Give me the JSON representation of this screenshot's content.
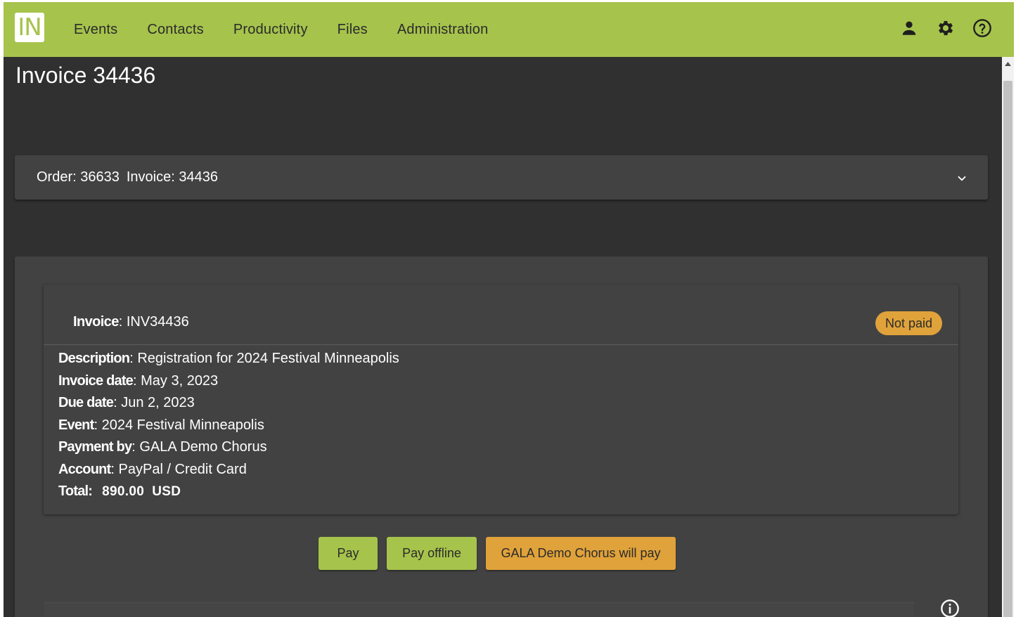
{
  "app": {
    "logo_text": "IN",
    "nav": [
      "Events",
      "Contacts",
      "Productivity",
      "Files",
      "Administration"
    ],
    "icons": [
      "person-icon",
      "gear-icon",
      "help-icon"
    ],
    "colors": {
      "accent": "#a6c34c",
      "warning": "#e0a23a",
      "background": "#303030",
      "card": "#424242"
    }
  },
  "page": {
    "title": "Invoice 34436"
  },
  "order_bar": {
    "order_label": "Order: 36633",
    "invoice_label": "Invoice: 34436"
  },
  "invoice": {
    "header_label": "Invoice",
    "header_value": ": INV34436",
    "status": "Not paid",
    "fields": [
      {
        "label": "Description",
        "value": ": Registration for 2024 Festival Minneapolis"
      },
      {
        "label": "Invoice date",
        "value": ": May 3, 2023"
      },
      {
        "label": "Due date",
        "value": ": Jun 2, 2023"
      },
      {
        "label": "Event",
        "value": ": 2024 Festival Minneapolis"
      },
      {
        "label": "Payment by",
        "value": ": GALA Demo Chorus"
      },
      {
        "label": "Account",
        "value": ": PayPal / Credit Card"
      }
    ],
    "total_label": "Total:",
    "total_value": "890.00  USD"
  },
  "actions": {
    "pay": "Pay",
    "pay_offline": "Pay offline",
    "third_party": "GALA Demo Chorus will pay"
  }
}
